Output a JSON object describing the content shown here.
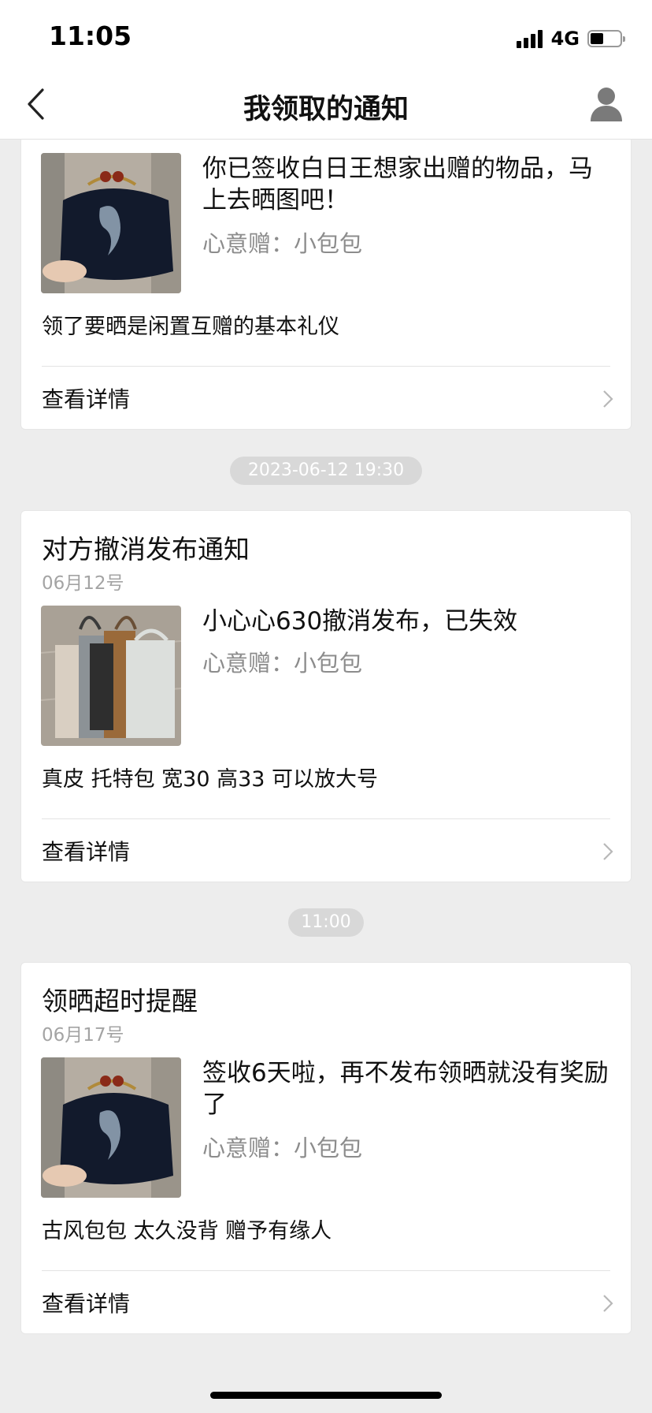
{
  "status": {
    "time": "11:05",
    "network": "4G",
    "battery_level": 0.45
  },
  "nav": {
    "title": "我领取的通知",
    "back_icon": "chevron-left-icon",
    "user_icon": "user-icon"
  },
  "cards": [
    {
      "headline": "你已签收白日王想家出赠的物品，马上去晒图吧！",
      "gift": "心意赠：小包包",
      "desc": "领了要晒是闲置互赠的基本礼仪",
      "details": "查看详情"
    },
    {
      "title": "对方撤消发布通知",
      "date": "06月12号",
      "headline": "小心心630撤消发布，已失效",
      "gift": "心意赠：小包包",
      "desc": "真皮 托特包 宽30 高33 可以放大号",
      "details": "查看详情"
    },
    {
      "title": "领晒超时提醒",
      "date": "06月17号",
      "headline": "签收6天啦，再不发布领晒就没有奖励了",
      "gift": "心意赠：小包包",
      "desc": "古风包包 太久没背 赠予有缘人",
      "details": "查看详情"
    }
  ],
  "timestamps": [
    "2023-06-12 19:30",
    "11:00"
  ],
  "colors": {
    "page_bg": "#ededed",
    "card_bg": "#ffffff",
    "muted_text": "#8c8c8c",
    "pill_bg": "#d8d8d8"
  }
}
